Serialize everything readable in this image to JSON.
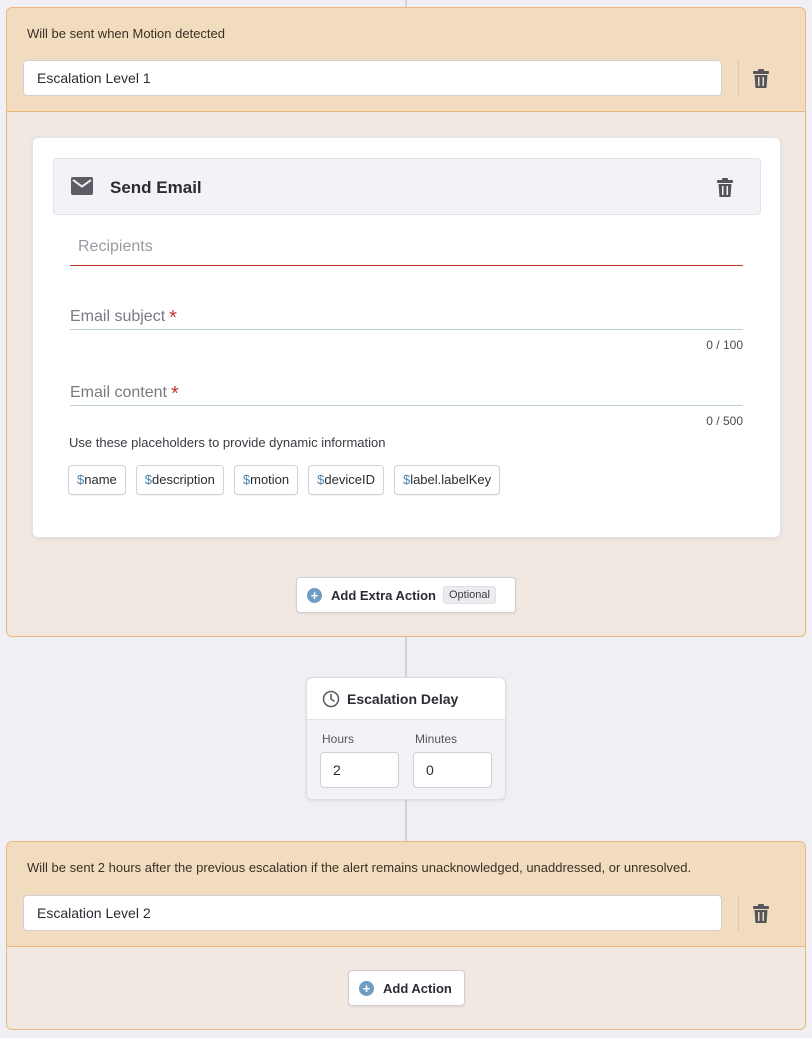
{
  "escalation1": {
    "note": "Will be sent when Motion detected",
    "name_value": "Escalation Level 1"
  },
  "action": {
    "title": "Send Email",
    "recipients_placeholder": "Recipients",
    "subject_label": "Email subject",
    "subject_counter": "0 / 100",
    "content_label": "Email content",
    "content_counter": "0 / 500",
    "required_mark": "*",
    "placeholder_help": "Use these placeholders to provide dynamic information",
    "placeholders": [
      {
        "prefix": "$",
        "name": "name"
      },
      {
        "prefix": "$",
        "name": "description"
      },
      {
        "prefix": "$",
        "name": "motion"
      },
      {
        "prefix": "$",
        "name": "deviceID"
      },
      {
        "prefix": "$",
        "name": "label.labelKey"
      }
    ]
  },
  "add_extra_action": {
    "label": "Add Extra Action",
    "tag": "Optional",
    "plus_icon": "+"
  },
  "delay": {
    "title": "Escalation Delay",
    "hours_label": "Hours",
    "hours_value": "2",
    "minutes_label": "Minutes",
    "minutes_value": "0"
  },
  "escalation2": {
    "note": "Will be sent 2 hours after the previous escalation if the alert remains unacknowledged, unaddressed, or unresolved.",
    "name_value": "Escalation Level 2"
  },
  "add_action": {
    "label": "Add Action",
    "plus_icon": "+"
  },
  "icons": [
    "trash-icon",
    "mail-icon",
    "plus-circle-icon",
    "clock-icon"
  ],
  "colors": {
    "level_border": "#e9b77a",
    "level_header_bg": "#f2dcbf",
    "level_body_bg": "#f1e9e1",
    "error_red": "#c0392b",
    "accent_blue": "#6f9cc4"
  }
}
